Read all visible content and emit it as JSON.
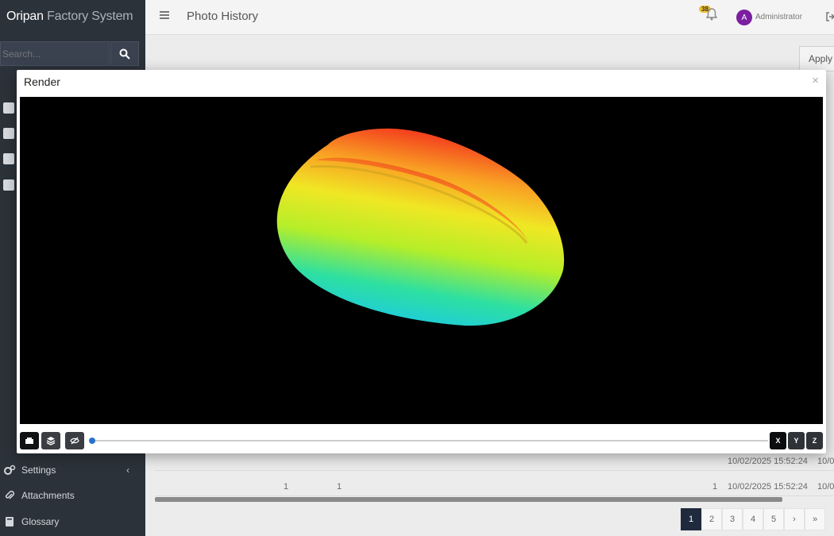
{
  "app": {
    "brand_primary": "Oripan",
    "brand_secondary": "Factory System"
  },
  "sidebar": {
    "search_placeholder": "Search...",
    "items": [
      {
        "label": "Settings",
        "icon": "gear-icon"
      },
      {
        "label": "Attachments",
        "icon": "paperclip-icon"
      },
      {
        "label": "Glossary",
        "icon": "book-icon"
      }
    ]
  },
  "header": {
    "page_title": "Photo History",
    "notification_count": "38",
    "avatar_initial": "A",
    "user_name": "Administrator"
  },
  "toolbar": {
    "apply_label": "Apply"
  },
  "table": {
    "rows": [
      {
        "col_a": "",
        "col_b": "",
        "col_c": "",
        "date": "10/02/2025 15:52:24",
        "tail": "10/0"
      },
      {
        "col_a": "1",
        "col_b": "1",
        "col_c": "1",
        "date": "10/02/2025 15:52:24",
        "tail": "10/0"
      }
    ]
  },
  "pagination": {
    "pages": [
      "1",
      "2",
      "3",
      "4",
      "5"
    ],
    "next": "›",
    "last": "»",
    "active": "1"
  },
  "modal": {
    "title": "Render",
    "close_label": "×",
    "view_controls": [
      {
        "name": "box-view-icon"
      },
      {
        "name": "layers-icon"
      },
      {
        "name": "eye-off-icon"
      }
    ],
    "slider_value": 0,
    "axes": [
      "X",
      "Y",
      "Z"
    ]
  },
  "colors": {
    "sidebar_bg": "#2c323a",
    "accent": "#2a73c9",
    "pagination_active": "#1f2a3d",
    "avatar": "#7b1fa2",
    "badge": "#f2c230"
  }
}
